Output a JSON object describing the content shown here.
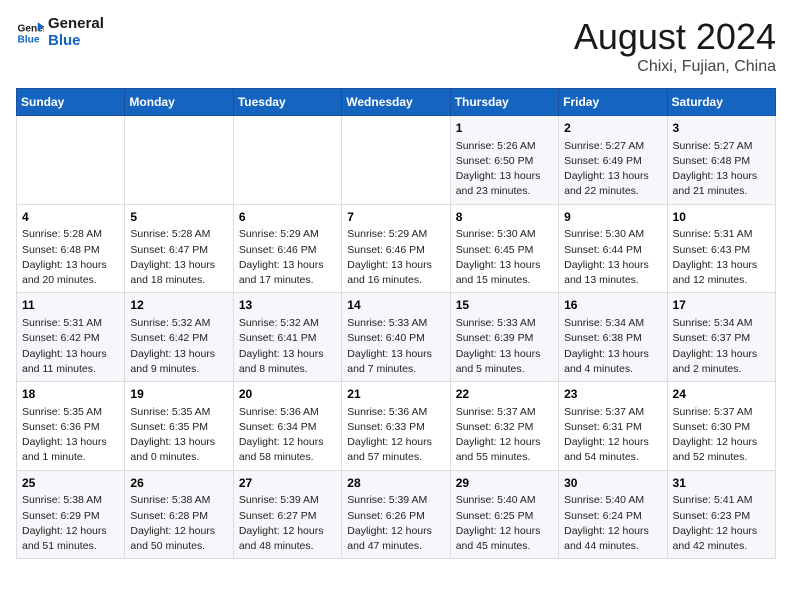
{
  "header": {
    "logo_line1": "General",
    "logo_line2": "Blue",
    "month_year": "August 2024",
    "location": "Chixi, Fujian, China"
  },
  "days_of_week": [
    "Sunday",
    "Monday",
    "Tuesday",
    "Wednesday",
    "Thursday",
    "Friday",
    "Saturday"
  ],
  "weeks": [
    [
      {
        "day": "",
        "info": ""
      },
      {
        "day": "",
        "info": ""
      },
      {
        "day": "",
        "info": ""
      },
      {
        "day": "",
        "info": ""
      },
      {
        "day": "1",
        "info": "Sunrise: 5:26 AM\nSunset: 6:50 PM\nDaylight: 13 hours\nand 23 minutes."
      },
      {
        "day": "2",
        "info": "Sunrise: 5:27 AM\nSunset: 6:49 PM\nDaylight: 13 hours\nand 22 minutes."
      },
      {
        "day": "3",
        "info": "Sunrise: 5:27 AM\nSunset: 6:48 PM\nDaylight: 13 hours\nand 21 minutes."
      }
    ],
    [
      {
        "day": "4",
        "info": "Sunrise: 5:28 AM\nSunset: 6:48 PM\nDaylight: 13 hours\nand 20 minutes."
      },
      {
        "day": "5",
        "info": "Sunrise: 5:28 AM\nSunset: 6:47 PM\nDaylight: 13 hours\nand 18 minutes."
      },
      {
        "day": "6",
        "info": "Sunrise: 5:29 AM\nSunset: 6:46 PM\nDaylight: 13 hours\nand 17 minutes."
      },
      {
        "day": "7",
        "info": "Sunrise: 5:29 AM\nSunset: 6:46 PM\nDaylight: 13 hours\nand 16 minutes."
      },
      {
        "day": "8",
        "info": "Sunrise: 5:30 AM\nSunset: 6:45 PM\nDaylight: 13 hours\nand 15 minutes."
      },
      {
        "day": "9",
        "info": "Sunrise: 5:30 AM\nSunset: 6:44 PM\nDaylight: 13 hours\nand 13 minutes."
      },
      {
        "day": "10",
        "info": "Sunrise: 5:31 AM\nSunset: 6:43 PM\nDaylight: 13 hours\nand 12 minutes."
      }
    ],
    [
      {
        "day": "11",
        "info": "Sunrise: 5:31 AM\nSunset: 6:42 PM\nDaylight: 13 hours\nand 11 minutes."
      },
      {
        "day": "12",
        "info": "Sunrise: 5:32 AM\nSunset: 6:42 PM\nDaylight: 13 hours\nand 9 minutes."
      },
      {
        "day": "13",
        "info": "Sunrise: 5:32 AM\nSunset: 6:41 PM\nDaylight: 13 hours\nand 8 minutes."
      },
      {
        "day": "14",
        "info": "Sunrise: 5:33 AM\nSunset: 6:40 PM\nDaylight: 13 hours\nand 7 minutes."
      },
      {
        "day": "15",
        "info": "Sunrise: 5:33 AM\nSunset: 6:39 PM\nDaylight: 13 hours\nand 5 minutes."
      },
      {
        "day": "16",
        "info": "Sunrise: 5:34 AM\nSunset: 6:38 PM\nDaylight: 13 hours\nand 4 minutes."
      },
      {
        "day": "17",
        "info": "Sunrise: 5:34 AM\nSunset: 6:37 PM\nDaylight: 13 hours\nand 2 minutes."
      }
    ],
    [
      {
        "day": "18",
        "info": "Sunrise: 5:35 AM\nSunset: 6:36 PM\nDaylight: 13 hours\nand 1 minute."
      },
      {
        "day": "19",
        "info": "Sunrise: 5:35 AM\nSunset: 6:35 PM\nDaylight: 13 hours\nand 0 minutes."
      },
      {
        "day": "20",
        "info": "Sunrise: 5:36 AM\nSunset: 6:34 PM\nDaylight: 12 hours\nand 58 minutes."
      },
      {
        "day": "21",
        "info": "Sunrise: 5:36 AM\nSunset: 6:33 PM\nDaylight: 12 hours\nand 57 minutes."
      },
      {
        "day": "22",
        "info": "Sunrise: 5:37 AM\nSunset: 6:32 PM\nDaylight: 12 hours\nand 55 minutes."
      },
      {
        "day": "23",
        "info": "Sunrise: 5:37 AM\nSunset: 6:31 PM\nDaylight: 12 hours\nand 54 minutes."
      },
      {
        "day": "24",
        "info": "Sunrise: 5:37 AM\nSunset: 6:30 PM\nDaylight: 12 hours\nand 52 minutes."
      }
    ],
    [
      {
        "day": "25",
        "info": "Sunrise: 5:38 AM\nSunset: 6:29 PM\nDaylight: 12 hours\nand 51 minutes."
      },
      {
        "day": "26",
        "info": "Sunrise: 5:38 AM\nSunset: 6:28 PM\nDaylight: 12 hours\nand 50 minutes."
      },
      {
        "day": "27",
        "info": "Sunrise: 5:39 AM\nSunset: 6:27 PM\nDaylight: 12 hours\nand 48 minutes."
      },
      {
        "day": "28",
        "info": "Sunrise: 5:39 AM\nSunset: 6:26 PM\nDaylight: 12 hours\nand 47 minutes."
      },
      {
        "day": "29",
        "info": "Sunrise: 5:40 AM\nSunset: 6:25 PM\nDaylight: 12 hours\nand 45 minutes."
      },
      {
        "day": "30",
        "info": "Sunrise: 5:40 AM\nSunset: 6:24 PM\nDaylight: 12 hours\nand 44 minutes."
      },
      {
        "day": "31",
        "info": "Sunrise: 5:41 AM\nSunset: 6:23 PM\nDaylight: 12 hours\nand 42 minutes."
      }
    ]
  ]
}
